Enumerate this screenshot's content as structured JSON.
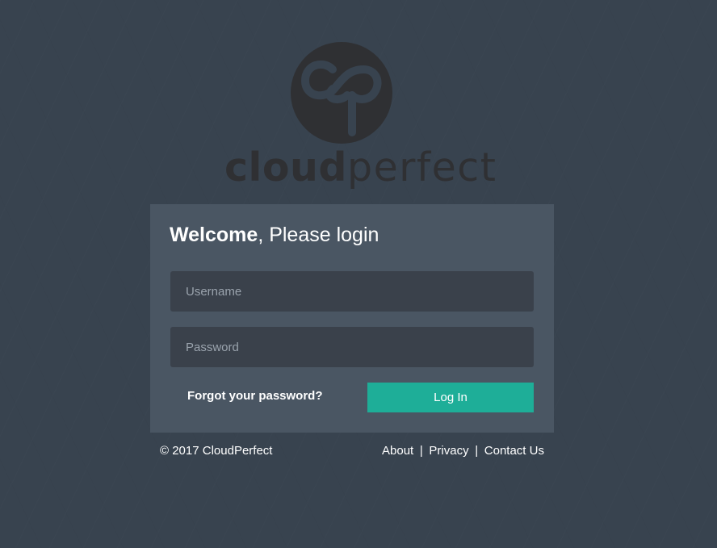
{
  "brand": {
    "name_bold": "cloud",
    "name_light": "perfect",
    "logo_color": "#2f3033"
  },
  "login": {
    "title_strong": "Welcome",
    "title_rest": ", Please login",
    "username_placeholder": "Username",
    "password_placeholder": "Password",
    "forgot_label": "Forgot your password?",
    "submit_label": "Log In"
  },
  "footer": {
    "copyright": "© 2017 CloudPerfect",
    "links": [
      "About",
      "Privacy",
      "Contact Us"
    ],
    "separator": "|"
  },
  "colors": {
    "background": "#38434f",
    "card": "#4a5663",
    "field": "#3a414b",
    "accent": "#1eae98",
    "text": "#ffffff"
  }
}
